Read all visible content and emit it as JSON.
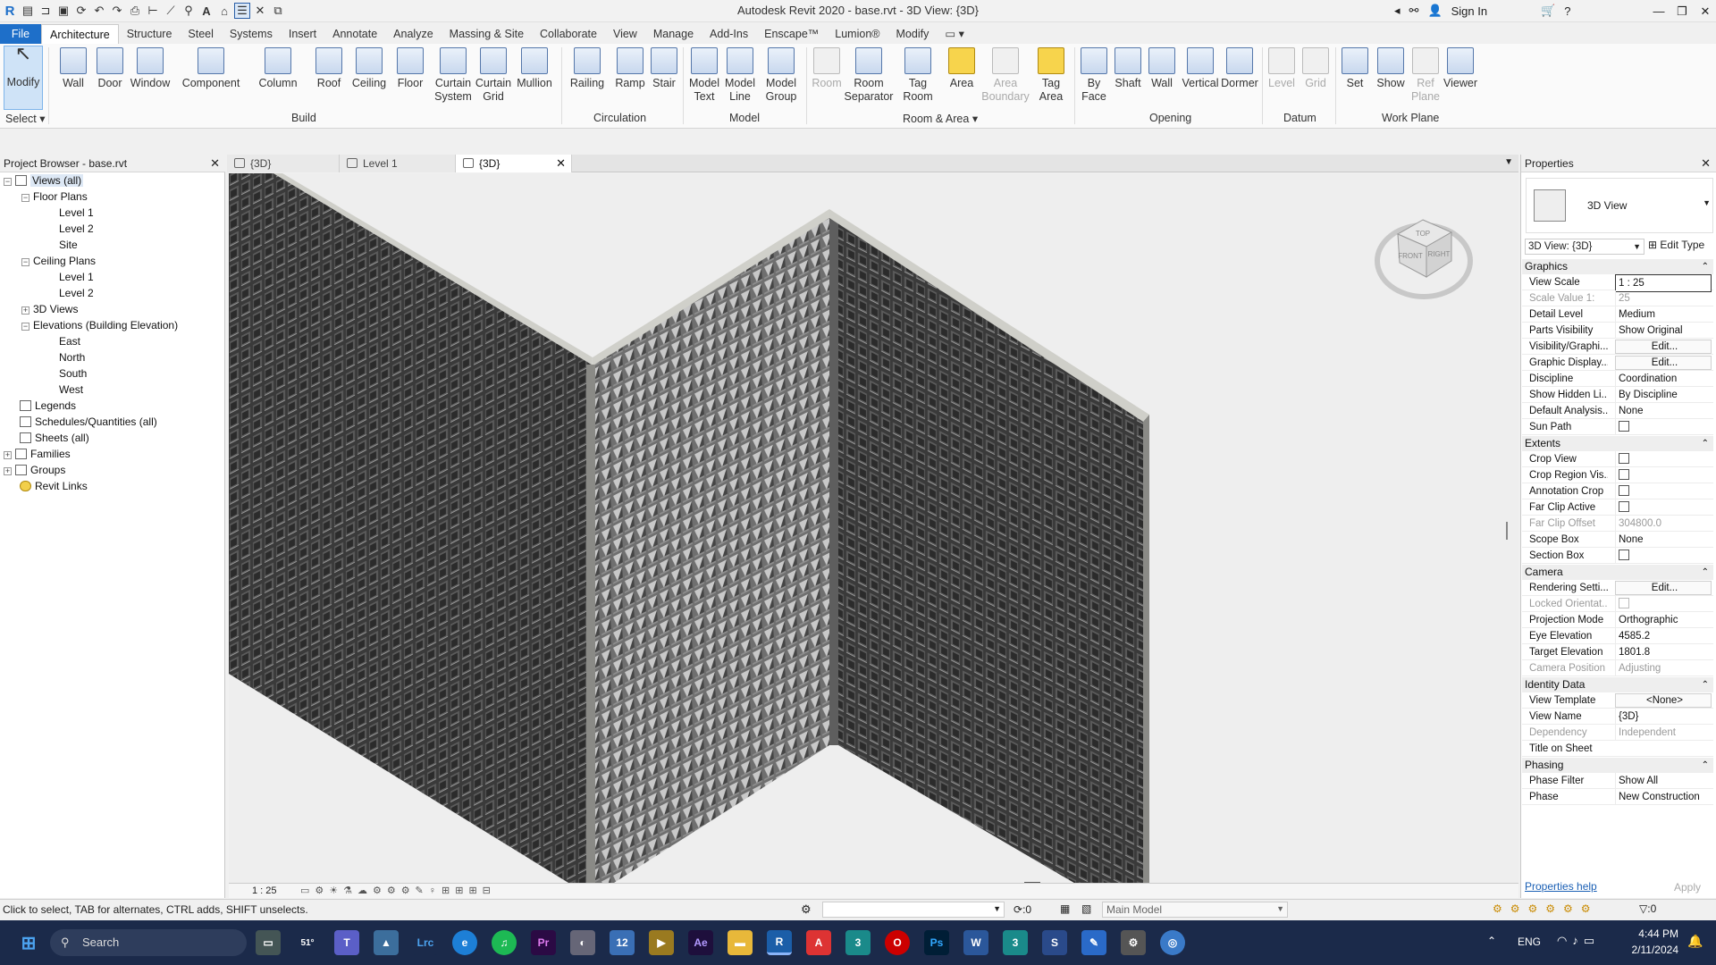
{
  "window": {
    "title": "Autodesk Revit 2020 - base.rvt - 3D View: {3D}",
    "sign_in": "Sign In"
  },
  "menu_tabs": [
    "File",
    "Architecture",
    "Structure",
    "Steel",
    "Systems",
    "Insert",
    "Annotate",
    "Analyze",
    "Massing & Site",
    "Collaborate",
    "View",
    "Manage",
    "Add-Ins",
    "Enscape™",
    "Lumion®",
    "Modify"
  ],
  "ribbon": {
    "buttons": [
      "Modify",
      "Wall",
      "Door",
      "Window",
      "Component",
      "Column",
      "Roof",
      "Ceiling",
      "Floor",
      "Curtain System",
      "Curtain Grid",
      "Mullion",
      "Railing",
      "Ramp",
      "Stair",
      "Model Text",
      "Model Line",
      "Model Group",
      "Room",
      "Room Separator",
      "Tag Room",
      "Area",
      "Area Boundary",
      "Tag Area",
      "By Face",
      "Shaft",
      "Wall",
      "Vertical",
      "Dormer",
      "Level",
      "Grid",
      "Set",
      "Show",
      "Ref Plane",
      "Viewer"
    ],
    "panels": [
      "Select",
      "Build",
      "Circulation",
      "Model",
      "Room & Area",
      "Opening",
      "Datum",
      "Work Plane"
    ]
  },
  "project_browser": {
    "title": "Project Browser - base.rvt",
    "tree": [
      {
        "label": "Views (all)"
      },
      {
        "label": "Floor Plans"
      },
      {
        "label": "Level 1"
      },
      {
        "label": "Level 2"
      },
      {
        "label": "Site"
      },
      {
        "label": "Ceiling Plans"
      },
      {
        "label": "Level 1"
      },
      {
        "label": "Level 2"
      },
      {
        "label": "3D Views"
      },
      {
        "label": "Elevations (Building Elevation)"
      },
      {
        "label": "East"
      },
      {
        "label": "North"
      },
      {
        "label": "South"
      },
      {
        "label": "West"
      },
      {
        "label": "Legends"
      },
      {
        "label": "Schedules/Quantities (all)"
      },
      {
        "label": "Sheets (all)"
      },
      {
        "label": "Families"
      },
      {
        "label": "Groups"
      },
      {
        "label": "Revit Links"
      }
    ]
  },
  "view_tabs": [
    "{3D}",
    "Level 1",
    "{3D}"
  ],
  "viewcube": {
    "top": "TOP",
    "front": "FRONT",
    "right": "RIGHT"
  },
  "view_control_bar": {
    "scale": "1 : 25"
  },
  "properties": {
    "title": "Properties",
    "type_name": "3D View",
    "selector": "3D View: {3D}",
    "edit_type": "Edit Type",
    "sections": {
      "graphics": "Graphics",
      "extents": "Extents",
      "camera": "Camera",
      "identity": "Identity Data",
      "phasing": "Phasing"
    },
    "rows": {
      "view_scale": [
        "View Scale",
        "1 : 25"
      ],
      "scale_value": [
        "Scale Value   1:",
        "25"
      ],
      "detail_level": [
        "Detail Level",
        "Medium"
      ],
      "parts_visibility": [
        "Parts Visibility",
        "Show Original"
      ],
      "vis_graphics": [
        "Visibility/Graphi...",
        "Edit..."
      ],
      "graphic_display": [
        "Graphic Display...",
        "Edit..."
      ],
      "discipline": [
        "Discipline",
        "Coordination"
      ],
      "show_hidden": [
        "Show Hidden Li...",
        "By Discipline"
      ],
      "default_analysis": [
        "Default Analysis...",
        "None"
      ],
      "sun_path": [
        "Sun Path",
        ""
      ],
      "crop_view": [
        "Crop View",
        ""
      ],
      "crop_region": [
        "Crop Region Vis...",
        ""
      ],
      "annotation_crop": [
        "Annotation Crop",
        ""
      ],
      "far_clip_active": [
        "Far Clip Active",
        ""
      ],
      "far_clip_offset": [
        "Far Clip Offset",
        "304800.0"
      ],
      "scope_box": [
        "Scope Box",
        "None"
      ],
      "section_box": [
        "Section Box",
        ""
      ],
      "rendering": [
        "Rendering Setti...",
        "Edit..."
      ],
      "locked_orient": [
        "Locked Orientat...",
        ""
      ],
      "projection": [
        "Projection Mode",
        "Orthographic"
      ],
      "eye_elev": [
        "Eye Elevation",
        "4585.2"
      ],
      "target_elev": [
        "Target Elevation",
        "1801.8"
      ],
      "camera_pos": [
        "Camera Position",
        "Adjusting"
      ],
      "view_template": [
        "View Template",
        "<None>"
      ],
      "view_name": [
        "View Name",
        "{3D}"
      ],
      "dependency": [
        "Dependency",
        "Independent"
      ],
      "title_on_sheet": [
        "Title on Sheet",
        ""
      ],
      "phase_filter": [
        "Phase Filter",
        "Show All"
      ],
      "phase": [
        "Phase",
        "New Construction"
      ]
    },
    "help": "Properties help",
    "apply": "Apply"
  },
  "status": {
    "hint": "Click to select, TAB for alternates, CTRL adds, SHIFT unselects.",
    "zero": ":0",
    "model": "Main Model",
    "filter_count": ":0"
  },
  "taskbar": {
    "search": "Search",
    "weather": "51°",
    "lang": "ENG",
    "time": "4:44 PM",
    "date": "2/11/2024"
  }
}
